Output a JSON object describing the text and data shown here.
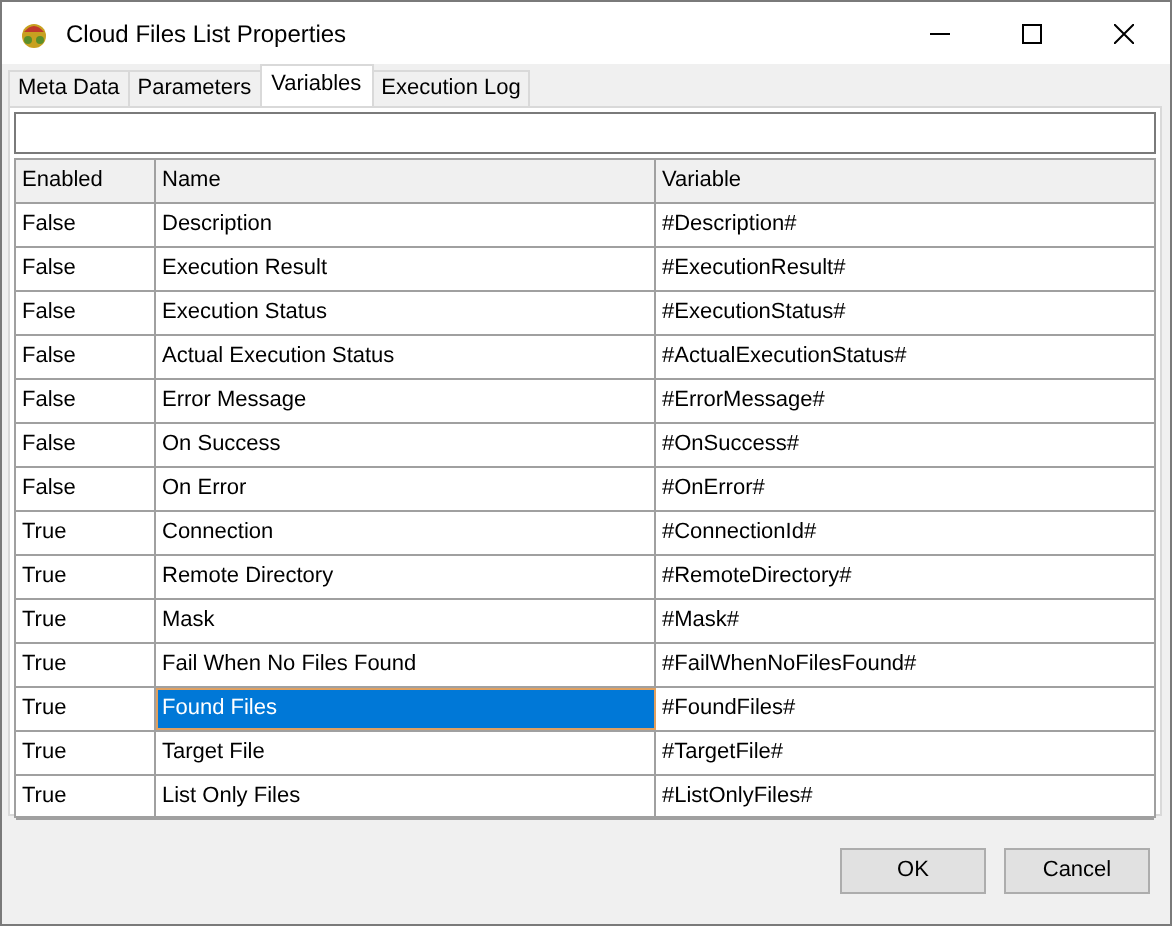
{
  "window": {
    "title": "Cloud Files List Properties"
  },
  "tabs": [
    {
      "label": "Meta Data",
      "selected": false
    },
    {
      "label": "Parameters",
      "selected": false
    },
    {
      "label": "Variables",
      "selected": true
    },
    {
      "label": "Execution Log",
      "selected": false
    }
  ],
  "table": {
    "columns": [
      "Enabled",
      "Name",
      "Variable"
    ],
    "rows": [
      {
        "enabled": "False",
        "name": "Description",
        "variable": "#Description#",
        "selected": false
      },
      {
        "enabled": "False",
        "name": "Execution Result",
        "variable": "#ExecutionResult#",
        "selected": false
      },
      {
        "enabled": "False",
        "name": "Execution Status",
        "variable": "#ExecutionStatus#",
        "selected": false
      },
      {
        "enabled": "False",
        "name": "Actual Execution Status",
        "variable": "#ActualExecutionStatus#",
        "selected": false
      },
      {
        "enabled": "False",
        "name": "Error Message",
        "variable": "#ErrorMessage#",
        "selected": false
      },
      {
        "enabled": "False",
        "name": "On Success",
        "variable": "#OnSuccess#",
        "selected": false
      },
      {
        "enabled": "False",
        "name": "On Error",
        "variable": "#OnError#",
        "selected": false
      },
      {
        "enabled": "True",
        "name": "Connection",
        "variable": "#ConnectionId#",
        "selected": false
      },
      {
        "enabled": "True",
        "name": "Remote Directory",
        "variable": "#RemoteDirectory#",
        "selected": false
      },
      {
        "enabled": "True",
        "name": "Mask",
        "variable": "#Mask#",
        "selected": false
      },
      {
        "enabled": "True",
        "name": "Fail When No Files Found",
        "variable": "#FailWhenNoFilesFound#",
        "selected": false
      },
      {
        "enabled": "True",
        "name": "Found Files",
        "variable": "#FoundFiles#",
        "selected": true
      },
      {
        "enabled": "True",
        "name": "Target File",
        "variable": "#TargetFile#",
        "selected": false
      },
      {
        "enabled": "True",
        "name": "List Only Files",
        "variable": "#ListOnlyFiles#",
        "selected": false
      }
    ]
  },
  "buttons": [
    "OK",
    "Cancel"
  ]
}
